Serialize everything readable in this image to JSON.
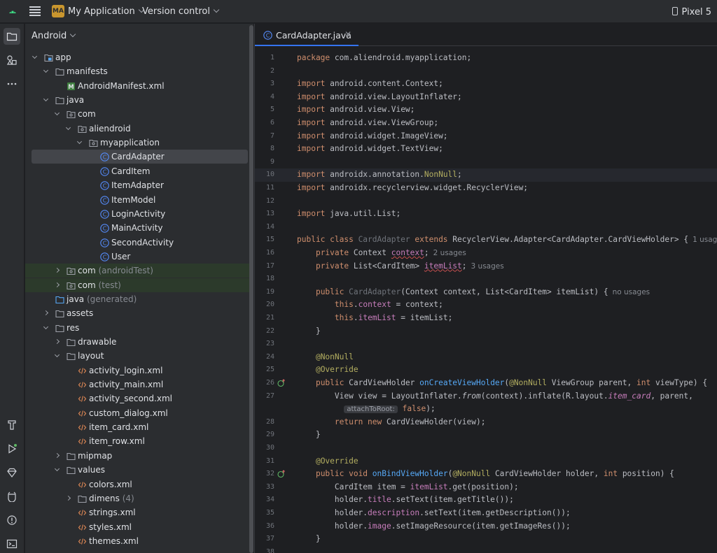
{
  "titlebar": {
    "project_badge": "MA",
    "project_name": "My Application",
    "vcs": "Version control",
    "device": "Pixel 5"
  },
  "project_panel": {
    "view_mode": "Android",
    "tree": [
      {
        "id": "app",
        "label": "app",
        "depth": 0,
        "expanded": true,
        "icon": "module-folder-icon"
      },
      {
        "id": "manifests",
        "label": "manifests",
        "depth": 1,
        "expanded": true,
        "icon": "folder-icon"
      },
      {
        "id": "androidmanifest",
        "label": "AndroidManifest.xml",
        "depth": 2,
        "icon": "manifest-icon"
      },
      {
        "id": "java",
        "label": "java",
        "depth": 1,
        "expanded": true,
        "icon": "folder-icon"
      },
      {
        "id": "com",
        "label": "com",
        "depth": 2,
        "expanded": true,
        "icon": "package-icon"
      },
      {
        "id": "aliendroid",
        "label": "aliendroid",
        "depth": 3,
        "expanded": true,
        "icon": "package-icon"
      },
      {
        "id": "myapplication",
        "label": "myapplication",
        "depth": 4,
        "expanded": true,
        "icon": "package-icon"
      },
      {
        "id": "cardadapter",
        "label": "CardAdapter",
        "depth": 5,
        "icon": "class-icon",
        "selected": true
      },
      {
        "id": "carditem",
        "label": "CardItem",
        "depth": 5,
        "icon": "class-icon"
      },
      {
        "id": "itemadapter",
        "label": "ItemAdapter",
        "depth": 5,
        "icon": "class-icon"
      },
      {
        "id": "itemmodel",
        "label": "ItemModel",
        "depth": 5,
        "icon": "class-icon"
      },
      {
        "id": "loginactivity",
        "label": "LoginActivity",
        "depth": 5,
        "icon": "class-icon"
      },
      {
        "id": "mainactivity",
        "label": "MainActivity",
        "depth": 5,
        "icon": "class-icon"
      },
      {
        "id": "secondactivity",
        "label": "SecondActivity",
        "depth": 5,
        "icon": "class-icon"
      },
      {
        "id": "user",
        "label": "User",
        "depth": 5,
        "icon": "class-icon"
      },
      {
        "id": "com-androidtest",
        "label": "com",
        "suffix": "(androidTest)",
        "depth": 2,
        "expanded": false,
        "icon": "package-icon",
        "green": true
      },
      {
        "id": "com-test",
        "label": "com",
        "suffix": "(test)",
        "depth": 2,
        "expanded": false,
        "icon": "package-icon",
        "green": true
      },
      {
        "id": "java-generated",
        "label": "java",
        "suffix": "(generated)",
        "depth": 1,
        "icon": "generated-folder-icon"
      },
      {
        "id": "assets",
        "label": "assets",
        "depth": 1,
        "expanded": false,
        "icon": "folder-icon"
      },
      {
        "id": "res",
        "label": "res",
        "depth": 1,
        "expanded": true,
        "icon": "folder-icon"
      },
      {
        "id": "drawable",
        "label": "drawable",
        "depth": 2,
        "expanded": false,
        "icon": "folder-icon"
      },
      {
        "id": "layout",
        "label": "layout",
        "depth": 2,
        "expanded": true,
        "icon": "folder-icon"
      },
      {
        "id": "activity_login",
        "label": "activity_login.xml",
        "depth": 3,
        "icon": "xml-icon"
      },
      {
        "id": "activity_main",
        "label": "activity_main.xml",
        "depth": 3,
        "icon": "xml-icon"
      },
      {
        "id": "activity_second",
        "label": "activity_second.xml",
        "depth": 3,
        "icon": "xml-icon"
      },
      {
        "id": "custom_dialog",
        "label": "custom_dialog.xml",
        "depth": 3,
        "icon": "xml-icon"
      },
      {
        "id": "item_card",
        "label": "item_card.xml",
        "depth": 3,
        "icon": "xml-icon"
      },
      {
        "id": "item_row",
        "label": "item_row.xml",
        "depth": 3,
        "icon": "xml-icon"
      },
      {
        "id": "mipmap",
        "label": "mipmap",
        "depth": 2,
        "expanded": false,
        "icon": "folder-icon"
      },
      {
        "id": "values",
        "label": "values",
        "depth": 2,
        "expanded": true,
        "icon": "folder-icon"
      },
      {
        "id": "colors",
        "label": "colors.xml",
        "depth": 3,
        "icon": "xml-icon"
      },
      {
        "id": "dimens",
        "label": "dimens",
        "suffix": "(4)",
        "depth": 3,
        "expanded": false,
        "icon": "folder-icon"
      },
      {
        "id": "strings",
        "label": "strings.xml",
        "depth": 3,
        "icon": "xml-icon"
      },
      {
        "id": "styles",
        "label": "styles.xml",
        "depth": 3,
        "icon": "xml-icon"
      },
      {
        "id": "themes",
        "label": "themes.xml",
        "depth": 3,
        "icon": "xml-icon"
      }
    ]
  },
  "editor": {
    "tab_label": "CardAdapter.java",
    "current_line": 10,
    "lines": [
      {
        "n": "1",
        "tokens": [
          [
            "kw",
            "package "
          ],
          [
            "",
            "com.aliendroid.myapplication;"
          ]
        ]
      },
      {
        "n": "2",
        "tokens": []
      },
      {
        "n": "3",
        "tokens": [
          [
            "kw",
            "import "
          ],
          [
            "",
            "android.content.Context;"
          ]
        ]
      },
      {
        "n": "4",
        "tokens": [
          [
            "kw",
            "import "
          ],
          [
            "",
            "android.view.LayoutInflater;"
          ]
        ]
      },
      {
        "n": "5",
        "tokens": [
          [
            "kw",
            "import "
          ],
          [
            "",
            "android.view.View;"
          ]
        ]
      },
      {
        "n": "6",
        "tokens": [
          [
            "kw",
            "import "
          ],
          [
            "",
            "android.view.ViewGroup;"
          ]
        ]
      },
      {
        "n": "7",
        "tokens": [
          [
            "kw",
            "import "
          ],
          [
            "",
            "android.widget.ImageView;"
          ]
        ]
      },
      {
        "n": "8",
        "tokens": [
          [
            "kw",
            "import "
          ],
          [
            "",
            "android.widget.TextView;"
          ]
        ]
      },
      {
        "n": "9",
        "tokens": []
      },
      {
        "n": "10",
        "tokens": [
          [
            "kw",
            "import "
          ],
          [
            "",
            "androidx.annotation."
          ],
          [
            "ann",
            "NonNull"
          ],
          [
            "",
            ";"
          ]
        ]
      },
      {
        "n": "11",
        "tokens": [
          [
            "kw",
            "import "
          ],
          [
            "",
            "androidx.recyclerview.widget.RecyclerView;"
          ]
        ]
      },
      {
        "n": "12",
        "tokens": []
      },
      {
        "n": "13",
        "tokens": [
          [
            "kw",
            "import "
          ],
          [
            "",
            "java.util.List;"
          ]
        ]
      },
      {
        "n": "14",
        "tokens": []
      },
      {
        "n": "15",
        "tokens": [
          [
            "kw",
            "public class "
          ],
          [
            "gray",
            "CardAdapter "
          ],
          [
            "kw",
            "extends "
          ],
          [
            "",
            "RecyclerView.Adapter<CardAdapter.CardViewHolder> {"
          ],
          [
            "hint",
            "1 usage"
          ]
        ]
      },
      {
        "n": "16",
        "tokens": [
          [
            "",
            "    "
          ],
          [
            "kw",
            "private "
          ],
          [
            "",
            "Context "
          ],
          [
            "fld squig",
            "context"
          ],
          [
            "",
            ";"
          ],
          [
            "hint",
            "2 usages"
          ]
        ]
      },
      {
        "n": "17",
        "tokens": [
          [
            "",
            "    "
          ],
          [
            "kw",
            "private "
          ],
          [
            "",
            "List<CardItem> "
          ],
          [
            "fld squig",
            "itemList"
          ],
          [
            "",
            ";"
          ],
          [
            "hint",
            "3 usages"
          ]
        ]
      },
      {
        "n": "18",
        "tokens": []
      },
      {
        "n": "19",
        "tokens": [
          [
            "",
            "    "
          ],
          [
            "kw",
            "public "
          ],
          [
            "gray",
            "CardAdapter"
          ],
          [
            "",
            "(Context context, List<CardItem> itemList) {"
          ],
          [
            "hint",
            "no usages"
          ]
        ]
      },
      {
        "n": "20",
        "tokens": [
          [
            "",
            "        "
          ],
          [
            "kw",
            "this"
          ],
          [
            "",
            "."
          ],
          [
            "fld",
            "context"
          ],
          [
            "",
            " = context;"
          ]
        ]
      },
      {
        "n": "21",
        "tokens": [
          [
            "",
            "        "
          ],
          [
            "kw",
            "this"
          ],
          [
            "",
            "."
          ],
          [
            "fld",
            "itemList"
          ],
          [
            "",
            " = itemList;"
          ]
        ]
      },
      {
        "n": "22",
        "tokens": [
          [
            "",
            "    }"
          ]
        ]
      },
      {
        "n": "23",
        "tokens": []
      },
      {
        "n": "24",
        "tokens": [
          [
            "",
            "    "
          ],
          [
            "ann",
            "@NonNull"
          ]
        ]
      },
      {
        "n": "25",
        "tokens": [
          [
            "",
            "    "
          ],
          [
            "ann",
            "@Override"
          ]
        ]
      },
      {
        "n": "26",
        "gutter": true,
        "tokens": [
          [
            "",
            "    "
          ],
          [
            "kw",
            "public "
          ],
          [
            "",
            "CardViewHolder "
          ],
          [
            "meth",
            "onCreateViewHolder"
          ],
          [
            "",
            "("
          ],
          [
            "ann",
            "@NonNull "
          ],
          [
            "",
            "ViewGroup parent, "
          ],
          [
            "kw",
            "int "
          ],
          [
            "",
            "viewType) {"
          ]
        ]
      },
      {
        "n": "27",
        "tokens": [
          [
            "",
            "        View view = LayoutInflater."
          ],
          [
            "ital",
            "from"
          ],
          [
            "",
            "(context).inflate(R.layout."
          ],
          [
            "fld ital",
            "item_card"
          ],
          [
            "",
            ", parent,"
          ]
        ]
      },
      {
        "n": "",
        "tokens": [
          [
            "",
            "          "
          ],
          [
            "inlay",
            "attachToRoot:"
          ],
          [
            "",
            " "
          ],
          [
            "kw",
            "false"
          ],
          [
            "",
            ");"
          ]
        ]
      },
      {
        "n": "28",
        "tokens": [
          [
            "",
            "        "
          ],
          [
            "kw",
            "return new "
          ],
          [
            "",
            "CardViewHolder(view);"
          ]
        ]
      },
      {
        "n": "29",
        "tokens": [
          [
            "",
            "    }"
          ]
        ]
      },
      {
        "n": "30",
        "tokens": []
      },
      {
        "n": "31",
        "tokens": [
          [
            "",
            "    "
          ],
          [
            "ann",
            "@Override"
          ]
        ]
      },
      {
        "n": "32",
        "gutter": true,
        "tokens": [
          [
            "",
            "    "
          ],
          [
            "kw",
            "public void "
          ],
          [
            "meth",
            "onBindViewHolder"
          ],
          [
            "",
            "("
          ],
          [
            "ann",
            "@NonNull "
          ],
          [
            "",
            "CardViewHolder holder, "
          ],
          [
            "kw",
            "int "
          ],
          [
            "",
            "position) {"
          ]
        ]
      },
      {
        "n": "33",
        "tokens": [
          [
            "",
            "        CardItem item = "
          ],
          [
            "fld",
            "itemList"
          ],
          [
            "",
            ".get(position);"
          ]
        ]
      },
      {
        "n": "34",
        "tokens": [
          [
            "",
            "        holder."
          ],
          [
            "fld",
            "title"
          ],
          [
            "",
            ".setText(item.getTitle());"
          ]
        ]
      },
      {
        "n": "35",
        "tokens": [
          [
            "",
            "        holder."
          ],
          [
            "fld",
            "description"
          ],
          [
            "",
            ".setText(item.getDescription());"
          ]
        ]
      },
      {
        "n": "36",
        "tokens": [
          [
            "",
            "        holder."
          ],
          [
            "fld",
            "image"
          ],
          [
            "",
            ".setImageResource(item.getImageRes());"
          ]
        ]
      },
      {
        "n": "37",
        "tokens": [
          [
            "",
            "    }"
          ]
        ]
      },
      {
        "n": "38",
        "tokens": []
      }
    ]
  },
  "colors": {
    "accent": "#3574f0",
    "badge": "#c9962e",
    "keyword": "#cf8e6d",
    "annotation": "#b3ae60",
    "field": "#c77dbb",
    "method": "#56a8f5"
  }
}
